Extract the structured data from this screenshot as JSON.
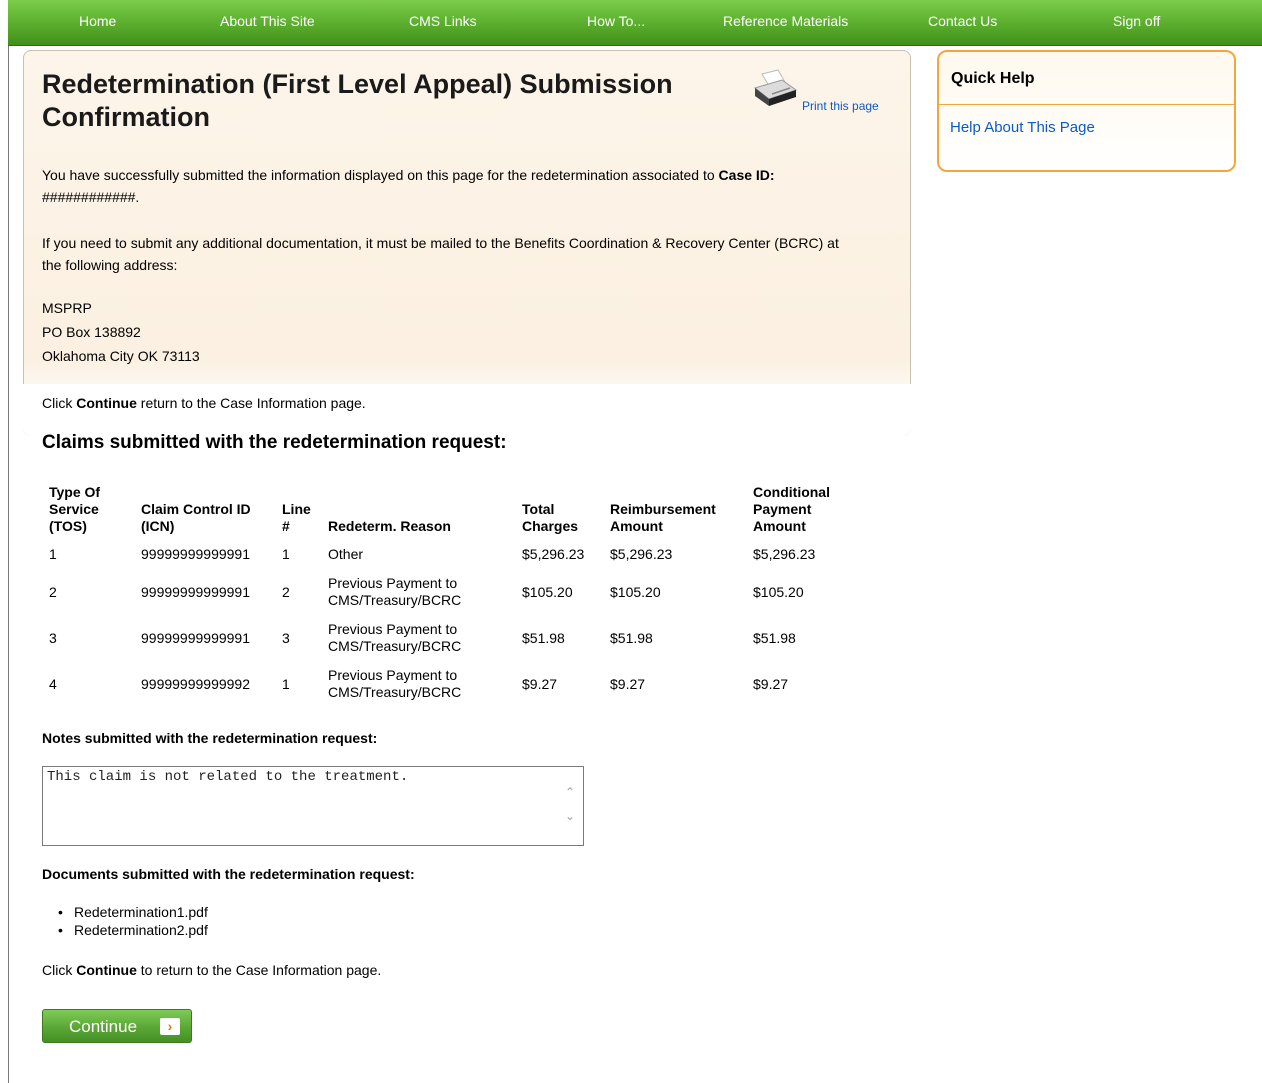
{
  "nav": {
    "items": [
      {
        "label": "Home"
      },
      {
        "label": "About This Site"
      },
      {
        "label": "CMS Links"
      },
      {
        "label": "How To..."
      },
      {
        "label": "Reference Materials"
      },
      {
        "label": "Contact Us"
      },
      {
        "label": "Sign off"
      }
    ]
  },
  "header": {
    "title": "Redetermination (First Level Appeal) Submission Confirmation",
    "print_label": "Print this page"
  },
  "intro": {
    "text": "You have successfully submitted the information displayed on this page for the redetermination associated to ",
    "case_id_label": "Case ID:",
    "case_id_value": "############."
  },
  "mail_notice": "If you need to submit any additional documentation, it must be mailed to the Benefits Coordination & Recovery Center (BCRC) at the following address:",
  "address": {
    "line1": "MSPRP",
    "line2": "PO Box 138892",
    "line3": "Oklahoma City OK 73113"
  },
  "continue_note_top": {
    "prefix": "Click ",
    "bold": "Continue",
    "suffix": " return to the Case Information page."
  },
  "claims": {
    "heading": "Claims submitted with the redetermination request:",
    "headers": {
      "tos": "Type Of Service (TOS)",
      "icn": "Claim Control ID (ICN)",
      "line": "Line #",
      "reason": "Redeterm. Reason",
      "total": "Total Charges",
      "reimb": "Reimbursement Amount",
      "cond": "Conditional Payment Amount"
    },
    "rows": [
      {
        "tos": "1",
        "icn": "99999999999991",
        "line": "1",
        "reason": "Other",
        "total": "$5,296.23",
        "reimb": "$5,296.23",
        "cond": "$5,296.23"
      },
      {
        "tos": "2",
        "icn": "99999999999991",
        "line": "2",
        "reason": "Previous Payment to CMS/Treasury/BCRC",
        "total": "$105.20",
        "reimb": "$105.20",
        "cond": "$105.20"
      },
      {
        "tos": "3",
        "icn": "99999999999991",
        "line": "3",
        "reason": "Previous Payment to CMS/Treasury/BCRC",
        "total": "$51.98",
        "reimb": "$51.98",
        "cond": "$51.98"
      },
      {
        "tos": "4",
        "icn": "99999999999992",
        "line": "1",
        "reason": "Previous Payment to CMS/Treasury/BCRC",
        "total": "$9.27",
        "reimb": "$9.27",
        "cond": "$9.27"
      }
    ]
  },
  "notes": {
    "label": "Notes submitted with the redetermination request:",
    "value": "This claim is not related to the treatment."
  },
  "documents": {
    "label": "Documents submitted with the redetermination request:",
    "files": [
      "Redetermination1.pdf",
      "Redetermination2.pdf"
    ]
  },
  "continue_note_bottom": {
    "prefix": "Click ",
    "bold": "Continue",
    "suffix": " to return to the Case Information page."
  },
  "continue_button": {
    "label": "Continue"
  },
  "quick_help": {
    "title": "Quick Help",
    "link": "Help About This Page"
  }
}
